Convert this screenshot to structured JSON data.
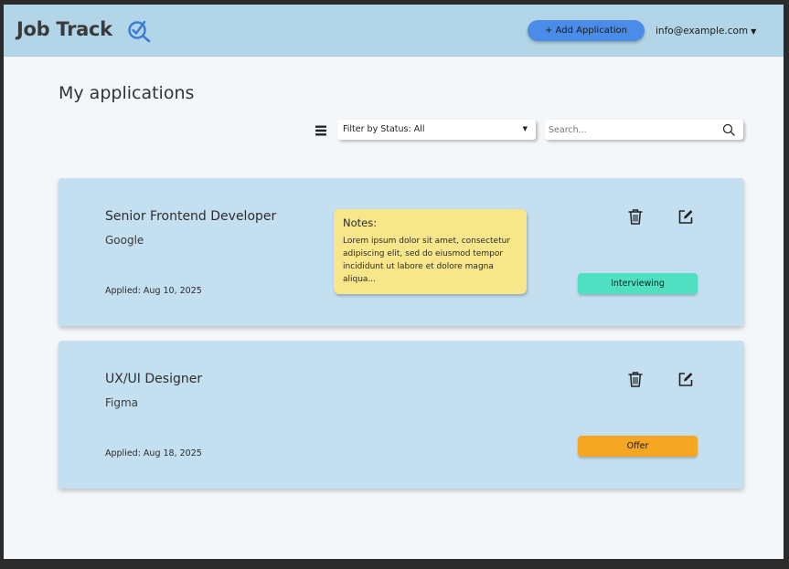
{
  "header": {
    "brand": "Job Track",
    "brand_icon": "magnifier-check-icon",
    "add_button": "+ Add Application",
    "user_email": "info@example.com",
    "user_caret": "▼"
  },
  "main": {
    "title": "My applications",
    "filter": {
      "label": "Filter by Status: All",
      "caret": "▼"
    },
    "search": {
      "placeholder": "Search..."
    }
  },
  "applications": [
    {
      "title": "Senior Frontend Developer",
      "company": "Google",
      "applied": "Applied: Aug 10, 2025",
      "notes_title": "Notes:",
      "notes_body": "Lorem ipsum dolor sit amet, consectetur adipiscing elit, sed do eiusmod tempor incididunt ut labore et dolore magna aliqua...",
      "status": "Interviewing",
      "status_color": "#4ee0c0"
    },
    {
      "title": "UX/UI Designer",
      "company": "Figma",
      "applied": "Applied: Aug 18, 2025",
      "status": "Offer",
      "status_color": "#f5a623"
    }
  ],
  "colors": {
    "header_bg": "#b2d6e8",
    "accent_button": "#4a8ce8",
    "card_bg": "#c3dff0",
    "note_bg": "#f8e68a"
  }
}
